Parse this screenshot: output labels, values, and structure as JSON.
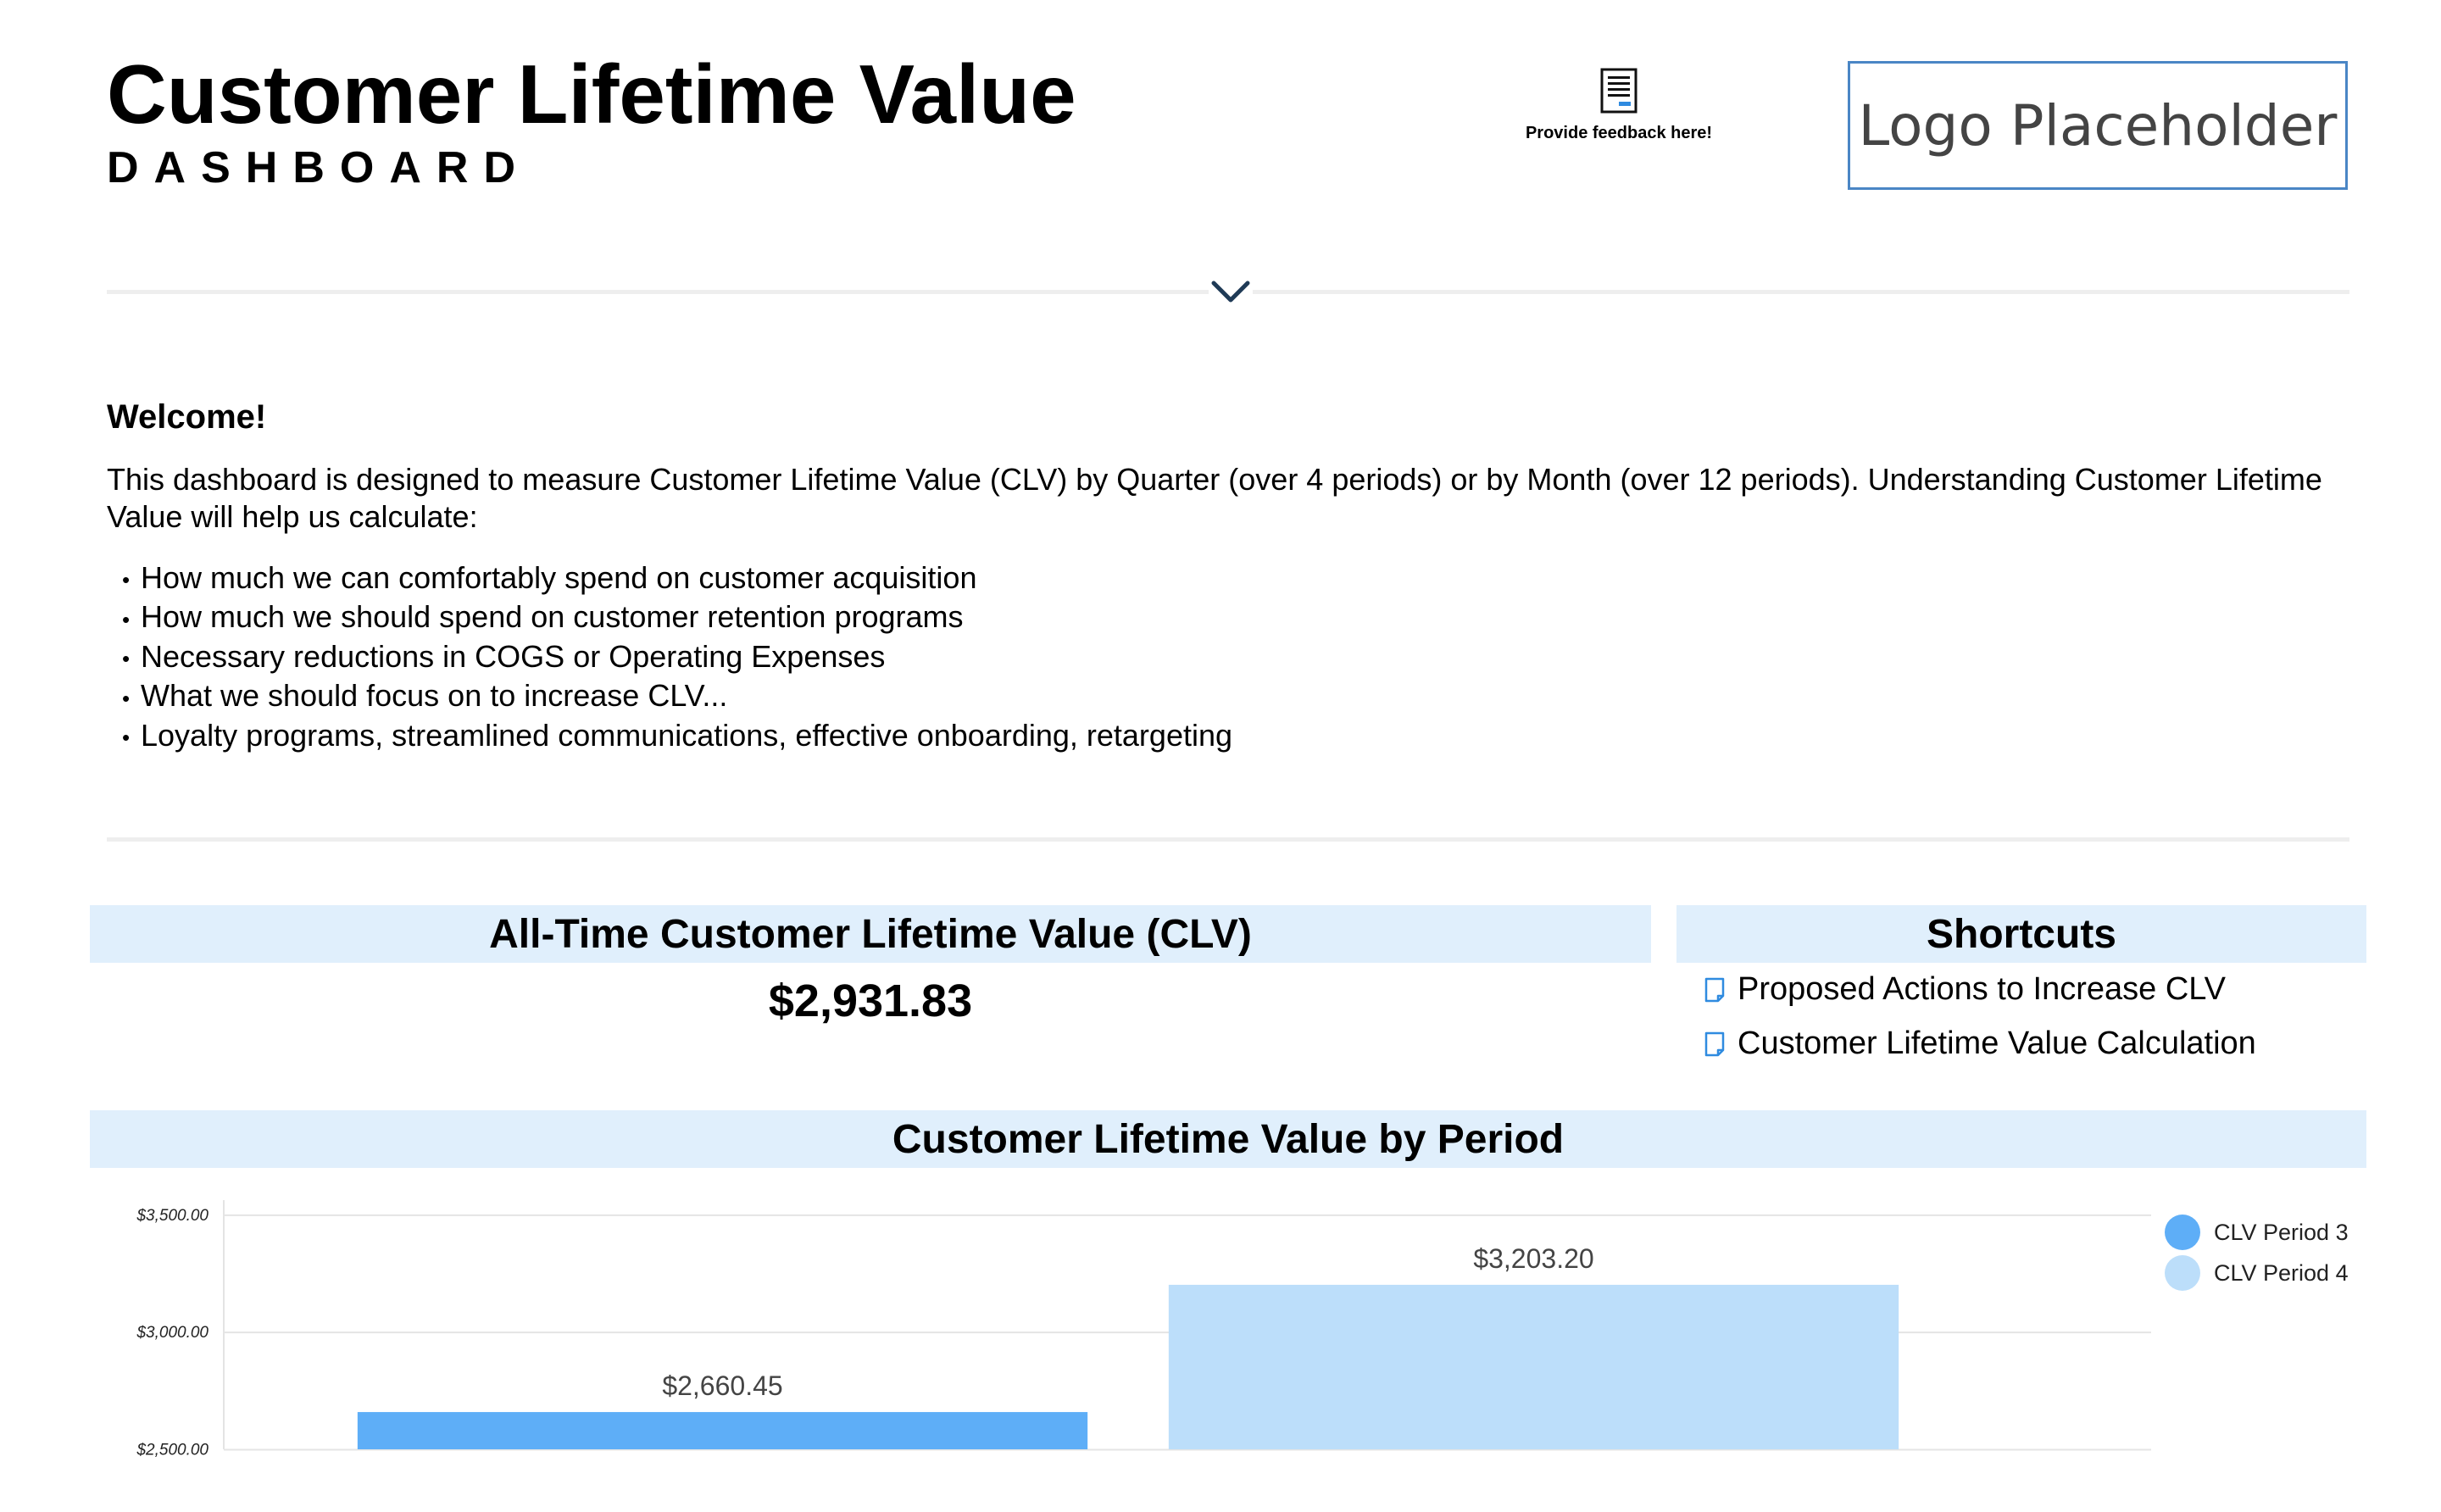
{
  "header": {
    "title": "Customer Lifetime Value",
    "subtitle": "DASHBOARD",
    "feedback_label": "Provide feedback here!",
    "feedback_icon": "document-icon",
    "logo_text": "Logo Placeholder",
    "collapse_icon": "chevron-down-icon"
  },
  "welcome": {
    "heading": "Welcome!",
    "text": "This dashboard is designed to measure Customer Lifetime Value (CLV) by Quarter (over 4 periods) or by Month (over 12 periods). Understanding Customer Lifetime Value will help us calculate:",
    "bullets": [
      "How much we can comfortably spend on customer acquisition",
      "How much we should spend on customer retention programs",
      "Necessary reductions in COGS or Operating Expenses",
      "What we should focus on to increase CLV...",
      "Loyalty programs, streamlined communications, effective onboarding, retargeting"
    ]
  },
  "clv_panel": {
    "heading": "All-Time Customer Lifetime Value (CLV)",
    "value": "$2,931.83"
  },
  "shortcuts": {
    "heading": "Shortcuts",
    "items": [
      {
        "label": "Proposed Actions to Increase CLV",
        "icon": "document-icon"
      },
      {
        "label": "Customer Lifetime Value Calculation",
        "icon": "document-icon"
      }
    ]
  },
  "period_panel": {
    "heading": "Customer Lifetime Value by Period"
  },
  "colors": {
    "panel_header_bg": "#e0effc",
    "logo_border": "#4a86c5",
    "series_1": "#5eaef7",
    "series_2": "#bcdefa",
    "chevron": "#1f3a56"
  },
  "chart_data": {
    "type": "bar",
    "title": "Customer Lifetime Value by Period",
    "xlabel": "",
    "ylabel": "",
    "ylim": [
      2480,
      3550
    ],
    "yticks": [
      2500,
      3000,
      3500
    ],
    "ytick_labels": [
      "$2,500.00",
      "$3,000.00",
      "$3,500.00"
    ],
    "grid": true,
    "legend_position": "top-right",
    "series": [
      {
        "name": "CLV Period 3",
        "value": 2660.45,
        "label": "$2,660.45",
        "color": "#5eaef7"
      },
      {
        "name": "CLV Period 4",
        "value": 3203.2,
        "label": "$3,203.20",
        "color": "#bcdefa"
      }
    ]
  }
}
